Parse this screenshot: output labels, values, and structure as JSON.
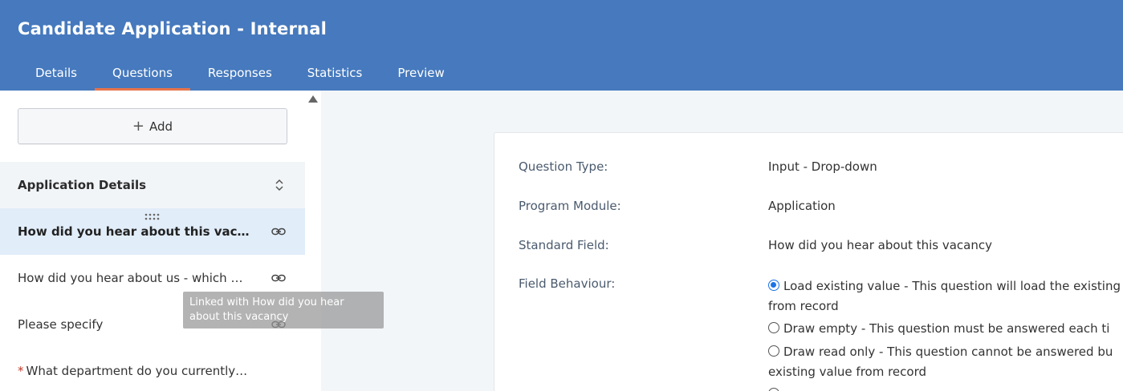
{
  "app": {
    "title": "Candidate Application - Internal"
  },
  "tabs": [
    {
      "label": "Details"
    },
    {
      "label": "Questions"
    },
    {
      "label": "Responses"
    },
    {
      "label": "Statistics"
    },
    {
      "label": "Preview"
    }
  ],
  "active_tab": "Questions",
  "sidebar": {
    "add_label": "Add",
    "section_title": "Application Details",
    "questions": [
      {
        "text": "How did you hear about this vacancy",
        "selected": true,
        "required": false,
        "linked": true
      },
      {
        "text": "How did you hear about us - which website",
        "selected": false,
        "required": false,
        "linked": true
      },
      {
        "text": "Please specify",
        "selected": false,
        "required": false,
        "linked": true
      },
      {
        "text": "What department do you currently work in?",
        "selected": false,
        "required": true,
        "required_mark": "*",
        "linked": false
      }
    ],
    "tooltip": "Linked with How did you hear about this vacancy"
  },
  "detail": {
    "question_type_label": "Question Type:",
    "question_type_value": "Input - Drop-down",
    "program_module_label": "Program Module:",
    "program_module_value": "Application",
    "standard_field_label": "Standard Field:",
    "standard_field_value": "How did you hear about this vacancy",
    "field_behaviour_label": "Field Behaviour:",
    "behaviours": [
      {
        "line1": "Load existing value - This question will load the existing",
        "line2": "from record",
        "checked": true
      },
      {
        "line1": "Draw empty - This question must be answered each ti",
        "line2": "",
        "checked": false
      },
      {
        "line1": "Draw read only - This question cannot be answered bu",
        "line2": "existing value from record",
        "checked": false
      }
    ]
  },
  "colors": {
    "header": "#4679bd",
    "tab_underline": "#e8734a",
    "selected_row": "#e1edf9",
    "radio_accent": "#1a73e8"
  }
}
